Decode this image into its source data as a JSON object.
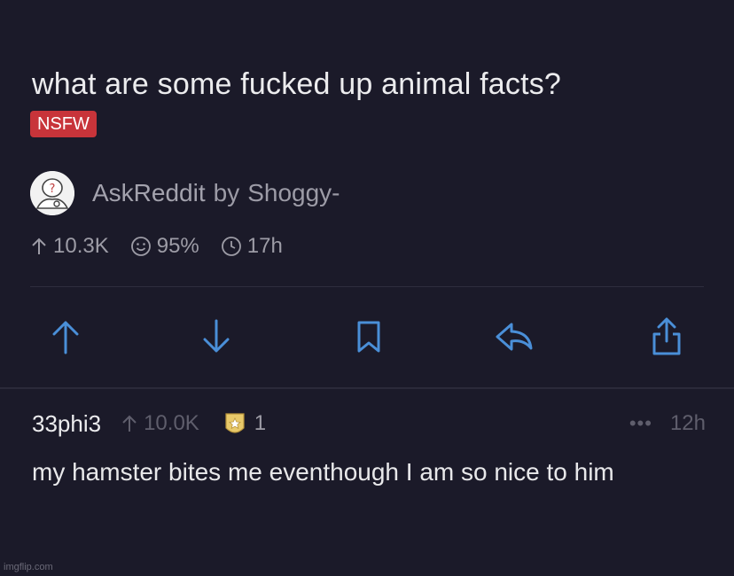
{
  "post": {
    "title": "what are some fucked up animal facts?",
    "nsfw_label": "NSFW",
    "subreddit": "AskReddit",
    "by_label": "by",
    "author": "Shoggy-",
    "stats": {
      "upvotes": "10.3K",
      "upvote_ratio": "95%",
      "age": "17h"
    }
  },
  "actions": [
    {
      "name": "upvote-button",
      "icon": "arrow-up-icon"
    },
    {
      "name": "downvote-button",
      "icon": "arrow-down-icon"
    },
    {
      "name": "save-button",
      "icon": "bookmark-icon"
    },
    {
      "name": "reply-button",
      "icon": "reply-arrow-icon"
    },
    {
      "name": "share-button",
      "icon": "share-icon"
    }
  ],
  "comment": {
    "author": "33phi3",
    "votes": "10.0K",
    "award_count": "1",
    "more": "•••",
    "age": "12h",
    "body": "my hamster bites me eventhough I am so nice to him"
  },
  "watermark": "imgflip.com",
  "colors": {
    "background": "#1b1a29",
    "accent_blue": "#4a8fd8",
    "nsfw_red": "#c8343a",
    "muted_text": "#9d9ca6"
  }
}
